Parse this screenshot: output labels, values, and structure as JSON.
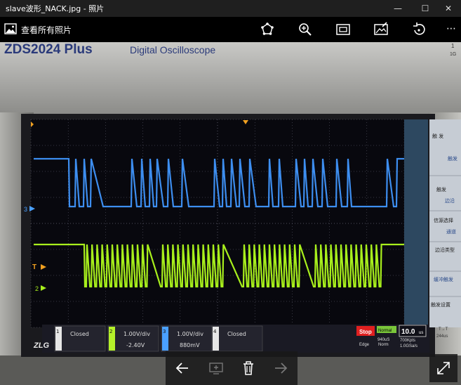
{
  "window": {
    "title": "slave波形_NACK.jpg - 照片",
    "minimize_glyph": "—",
    "maximize_glyph": "☐",
    "close_glyph": "✕"
  },
  "toolbar": {
    "collection_link": "查看所有照片",
    "more_glyph": "⋯",
    "icons": [
      "photos-icon",
      "share-icon",
      "zoom-icon",
      "slideshow-icon",
      "edit-icon",
      "rotate-icon",
      "more-icon"
    ]
  },
  "photo": {
    "brand": "ZDS2024 Plus",
    "product": "Digital Oscilloscope",
    "side_labels": [
      "1",
      "1G"
    ],
    "menu_items": [
      "触 发",
      "触发",
      "触发",
      "边沿",
      "信源选择",
      "通道",
      "边沿类型",
      "缓冲触发",
      "触发设置"
    ],
    "ch3_marker": "3",
    "trigger_marker": "T",
    "ch2_marker": "2",
    "channels": [
      {
        "num": "1",
        "status": "Closed",
        "sub": "",
        "color": "#e6e6e6"
      },
      {
        "num": "2",
        "status": "1.00V/div",
        "sub": "-2.40V",
        "color": "#b5f12a"
      },
      {
        "num": "3",
        "status": "1.00V/div",
        "sub": "880mV",
        "color": "#4aa0ff"
      },
      {
        "num": "4",
        "status": "Closed",
        "sub": "",
        "color": "#e6e6e6"
      }
    ],
    "status": {
      "stop": "Stop",
      "acq": "Normal",
      "acq_sub": "940uS",
      "time": "10.0",
      "time_unit": "us",
      "t_mode": "T→T",
      "sample": "244us",
      "rate": "700Kpts",
      "rate2": "1.0GSa/s",
      "edge": "Edge",
      "norm": "Norm"
    },
    "logo": "ZLG"
  },
  "colors": {
    "ch3_trace": "#3d8ef0",
    "ch2_trace": "#a8ef1c",
    "grid": "#6a6a7a",
    "screen": "#08080e",
    "stop": "#e02020"
  }
}
